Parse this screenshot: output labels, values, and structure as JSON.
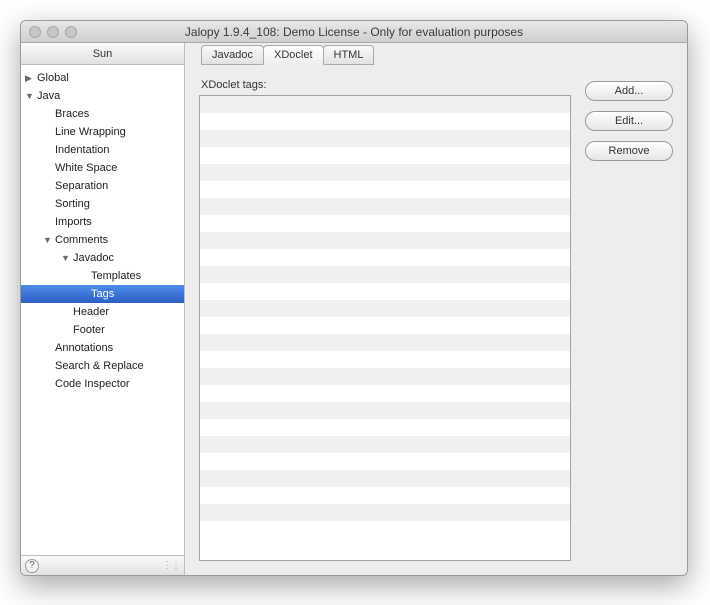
{
  "window": {
    "title": "Jalopy 1.9.4_108:  Demo License - Only for evaluation purposes"
  },
  "sidebar": {
    "header": "Sun",
    "items": [
      {
        "label": "Global",
        "indent": 0,
        "disclosure": "right",
        "selected": false
      },
      {
        "label": "Java",
        "indent": 0,
        "disclosure": "down",
        "selected": false
      },
      {
        "label": "Braces",
        "indent": 1,
        "disclosure": "",
        "selected": false
      },
      {
        "label": "Line Wrapping",
        "indent": 1,
        "disclosure": "",
        "selected": false
      },
      {
        "label": "Indentation",
        "indent": 1,
        "disclosure": "",
        "selected": false
      },
      {
        "label": "White Space",
        "indent": 1,
        "disclosure": "",
        "selected": false
      },
      {
        "label": "Separation",
        "indent": 1,
        "disclosure": "",
        "selected": false
      },
      {
        "label": "Sorting",
        "indent": 1,
        "disclosure": "",
        "selected": false
      },
      {
        "label": "Imports",
        "indent": 1,
        "disclosure": "",
        "selected": false
      },
      {
        "label": "Comments",
        "indent": 1,
        "disclosure": "down",
        "selected": false
      },
      {
        "label": "Javadoc",
        "indent": 2,
        "disclosure": "down",
        "selected": false
      },
      {
        "label": "Templates",
        "indent": 3,
        "disclosure": "",
        "selected": false
      },
      {
        "label": "Tags",
        "indent": 3,
        "disclosure": "",
        "selected": true
      },
      {
        "label": "Header",
        "indent": 2,
        "disclosure": "",
        "selected": false
      },
      {
        "label": "Footer",
        "indent": 2,
        "disclosure": "",
        "selected": false
      },
      {
        "label": "Annotations",
        "indent": 1,
        "disclosure": "",
        "selected": false
      },
      {
        "label": "Search & Replace",
        "indent": 1,
        "disclosure": "",
        "selected": false
      },
      {
        "label": "Code Inspector",
        "indent": 1,
        "disclosure": "",
        "selected": false
      }
    ]
  },
  "tabs": [
    {
      "label": "Javadoc",
      "active": false
    },
    {
      "label": "XDoclet",
      "active": true
    },
    {
      "label": "HTML",
      "active": false
    }
  ],
  "panel": {
    "listLabel": "XDoclet tags:"
  },
  "buttons": {
    "add": "Add...",
    "edit": "Edit...",
    "remove": "Remove"
  },
  "help_glyph": "?",
  "grip_glyph": "⋮⋮"
}
